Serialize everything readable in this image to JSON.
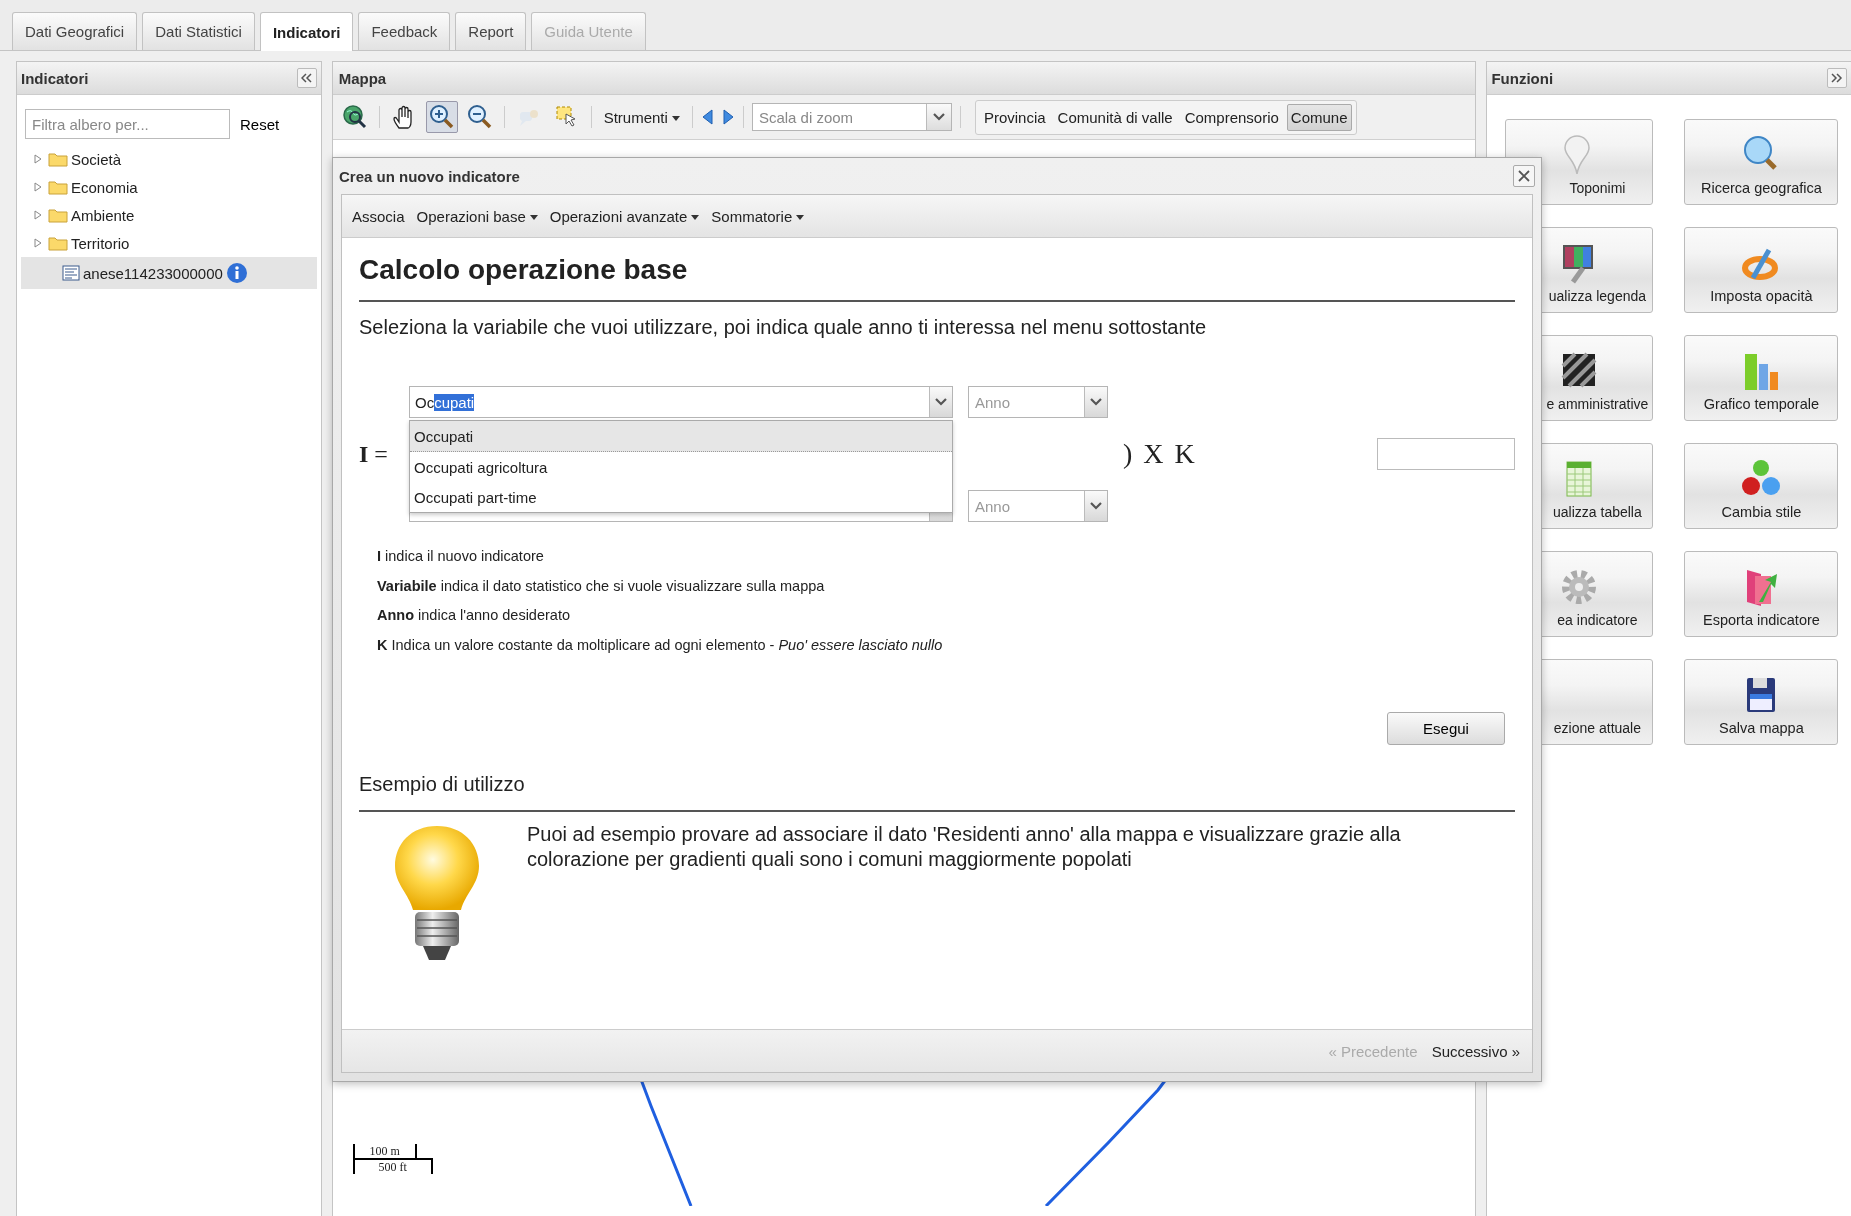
{
  "tabs": [
    {
      "label": "Dati Geografici",
      "selected": false,
      "disabled": false
    },
    {
      "label": "Dati Statistici",
      "selected": false,
      "disabled": false
    },
    {
      "label": "Indicatori",
      "selected": true,
      "disabled": false
    },
    {
      "label": "Feedback",
      "selected": false,
      "disabled": false
    },
    {
      "label": "Report",
      "selected": false,
      "disabled": false
    },
    {
      "label": "Guida Utente",
      "selected": false,
      "disabled": true
    }
  ],
  "left_panel": {
    "title": "Indicatori",
    "filter": {
      "placeholder": "Filtra albero per..."
    },
    "reset": "Reset",
    "tree": [
      {
        "label": "Società",
        "kind": "folder",
        "expanded": false,
        "selected": false
      },
      {
        "label": "Economia",
        "kind": "folder",
        "expanded": false,
        "selected": false
      },
      {
        "label": "Ambiente",
        "kind": "folder",
        "expanded": false,
        "selected": false
      },
      {
        "label": "Territorio",
        "kind": "folder",
        "expanded": false,
        "selected": false
      },
      {
        "label": "anese114233000000",
        "kind": "layer",
        "selected": true
      }
    ]
  },
  "map": {
    "title": "Mappa",
    "tools": [
      {
        "kind": "zoom-extent",
        "pressed": false,
        "disabled": false
      },
      {
        "kind": "pan",
        "pressed": false,
        "disabled": false
      },
      {
        "kind": "zoom-in",
        "pressed": true,
        "disabled": false
      },
      {
        "kind": "zoom-out",
        "pressed": false,
        "disabled": false
      },
      {
        "kind": "info",
        "pressed": false,
        "disabled": true
      },
      {
        "kind": "select",
        "pressed": false,
        "disabled": false
      }
    ],
    "menu": "Strumenti",
    "scale": {
      "placeholder": "Scala di zoom"
    },
    "levels": [
      {
        "label": "Provincia",
        "selected": false
      },
      {
        "label": "Comunità di valle",
        "selected": false
      },
      {
        "label": "Comprensorio",
        "selected": false
      },
      {
        "label": "Comune",
        "selected": true
      }
    ],
    "scale_bar": [
      "100 m",
      "500 ft"
    ]
  },
  "functions": {
    "title": "Funzioni",
    "buttons": [
      {
        "label": "Toponimi"
      },
      {
        "label": "Ricerca geografica"
      },
      {
        "label": "ualizza legenda"
      },
      {
        "label": "Imposta opacità"
      },
      {
        "label": "e amministrative"
      },
      {
        "label": "Grafico temporale"
      },
      {
        "label": "ualizza tabella"
      },
      {
        "label": "Cambia stile"
      },
      {
        "label": "ea indicatore"
      },
      {
        "label": "Esporta indicatore"
      },
      {
        "label": "ezione attuale"
      },
      {
        "label": "Salva mappa"
      }
    ]
  },
  "dialog": {
    "title": "Crea un nuovo indicatore",
    "menu": [
      {
        "label": "Associa",
        "has_menu": false
      },
      {
        "label": "Operazioni base",
        "has_menu": true
      },
      {
        "label": "Operazioni avanzate",
        "has_menu": true
      },
      {
        "label": "Sommatorie",
        "has_menu": true
      }
    ],
    "heading": "Calcolo operazione base",
    "intro": "Seleziona la variabile che vuoi utilizzare, poi indica quale anno ti interessa nel menu sottostante",
    "formula": {
      "lhs": "**I** =",
      "variable": {
        "typed": "Oc",
        "completion": "cupati"
      },
      "options": [
        {
          "label": "Occupati",
          "selected": true
        },
        {
          "label": "Occupati agricoltura",
          "selected": false
        },
        {
          "label": "Occupati part-time",
          "selected": false
        }
      ],
      "year_1": {
        "placeholder": "Anno"
      },
      "year_2": {
        "placeholder": "Anno"
      },
      "rhs": ") X K"
    },
    "legend": [
      "**I** indica il nuovo indicatore",
      "**Variabile** indica il dato statistico che si vuole visualizzare sulla mappa",
      "**Anno** indica l'anno desiderato",
      "**K** Indica un valore costante da moltiplicare ad ogni elemento - *Puo' essere lasciato nullo*"
    ],
    "run": "Esegui",
    "example": {
      "heading": "Esempio di utilizzo",
      "text": "Puoi ad esempio provare ad associare il dato 'Residenti anno' alla mappa e visualizzare grazie alla colorazione per gradienti quali sono i comuni maggiormente popolati"
    },
    "footer": {
      "previous": {
        "label": "« Precedente",
        "disabled": true
      },
      "next": {
        "label": "Successivo »",
        "disabled": false
      }
    }
  }
}
